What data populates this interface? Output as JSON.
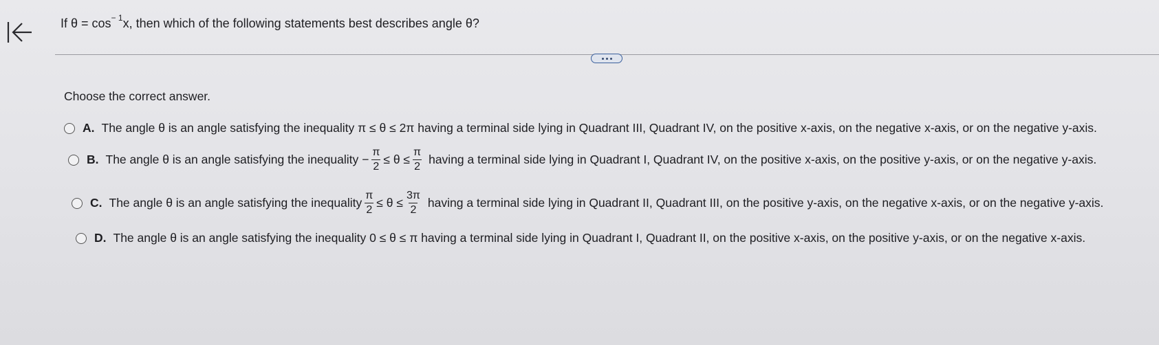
{
  "question": {
    "if_text": "If θ = cos",
    "sup": "− 1",
    "rest": "x, then which of the following statements best describes angle θ?"
  },
  "prompt": "Choose the correct answer.",
  "options": [
    {
      "letter": "A.",
      "pre": "The angle θ is an angle satisfying the inequality π ≤ θ ≤ 2π having a terminal side lying in Quadrant III, Quadrant IV, on the positive x-axis, on the negative x-axis, or on the negative y-axis."
    },
    {
      "letter": "B.",
      "pre": "The angle θ is an angle satisfying the inequality −",
      "f1_num": "π",
      "f1_den": "2",
      "mid": "≤ θ ≤",
      "f2_num": "π",
      "f2_den": "2",
      "post": "having a terminal side lying in Quadrant I, Quadrant IV, on the positive x-axis, on the positive y-axis, or on the negative y-axis."
    },
    {
      "letter": "C.",
      "pre": "The angle θ is an angle satisfying the inequality",
      "f1_num": "π",
      "f1_den": "2",
      "mid": "≤ θ ≤",
      "f2_num": "3π",
      "f2_den": "2",
      "post": "having a terminal side lying in Quadrant II, Quadrant III, on the positive y-axis, on the negative x-axis, or on the negative y-axis."
    },
    {
      "letter": "D.",
      "pre": "The angle θ is an angle satisfying the inequality 0 ≤ θ ≤ π having a terminal side lying in Quadrant I, Quadrant II, on the positive x-axis, on the positive y-axis, or on the negative x-axis."
    }
  ]
}
